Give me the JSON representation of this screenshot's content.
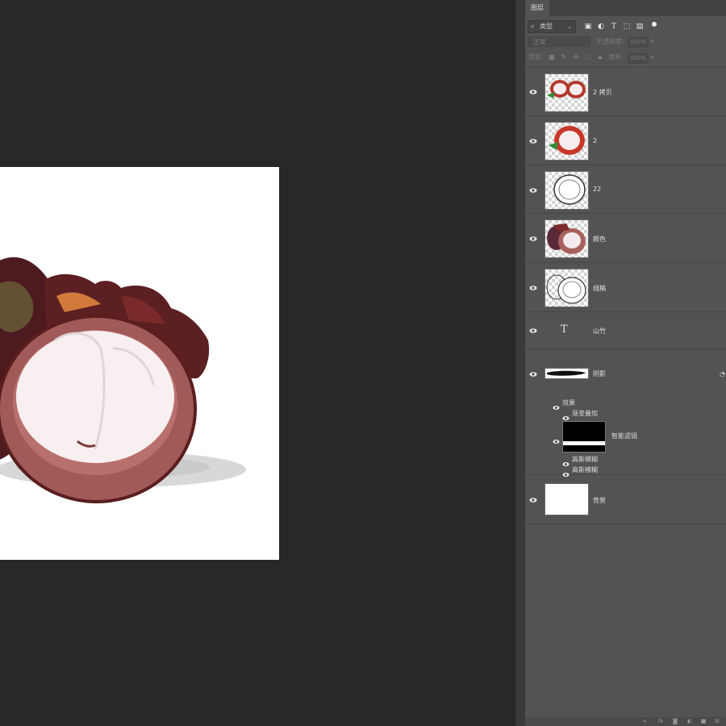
{
  "panel": {
    "tab_label": "图层",
    "filter": {
      "selected": "类型",
      "icons": [
        "image-filter-icon",
        "adjustment-filter-icon",
        "type-filter-icon",
        "shape-filter-icon",
        "smart-object-filter-icon"
      ]
    },
    "blend_mode": "正常",
    "opacity_label": "不透明度:",
    "opacity_value": "100%",
    "lock_label": "锁定:",
    "fill_label": "填充:",
    "fill_value": "100%"
  },
  "layers": [
    {
      "name": "2 拷贝",
      "kind": "pixel",
      "visible": true
    },
    {
      "name": "2",
      "kind": "pixel",
      "visible": true
    },
    {
      "name": "22",
      "kind": "pixel",
      "visible": true
    },
    {
      "name": "颜色",
      "kind": "pixel",
      "visible": true
    },
    {
      "name": "线稿",
      "kind": "pixel",
      "visible": true
    },
    {
      "name": "山竹",
      "kind": "type",
      "visible": true
    },
    {
      "name": "阴影",
      "kind": "smart-object",
      "visible": true,
      "effects_label": "效果",
      "effects": [
        {
          "name": "渐变叠加"
        }
      ],
      "smart_filters_label": "智能滤镜",
      "smart_filters": [
        {
          "name": "高斯模糊"
        },
        {
          "name": "高斯模糊"
        }
      ]
    },
    {
      "name": "背景",
      "kind": "background",
      "visible": true
    }
  ],
  "colors": {
    "workspace": "#282828",
    "panel": "#535353",
    "rind": "#a8615c",
    "rind_dark": "#5a1e1e",
    "flesh": "#f8eff1"
  }
}
